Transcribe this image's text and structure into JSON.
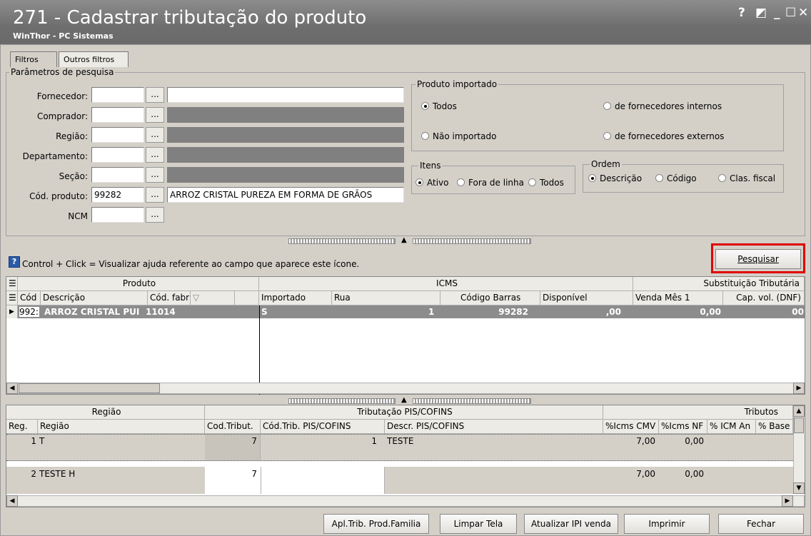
{
  "window": {
    "title": "271 - Cadastrar tributação do produto",
    "subtitle": "WinThor - PC Sistemas",
    "controls": [
      "?",
      "◩",
      "_",
      "☐",
      "✕"
    ]
  },
  "tabs": [
    "Filtros",
    "Outros filtros"
  ],
  "params": {
    "group_label": "Parâmetros de pesquisa",
    "fields": [
      {
        "label": "Fornecedor:",
        "code": "",
        "desc": ""
      },
      {
        "label": "Comprador:",
        "code": "",
        "desc": ""
      },
      {
        "label": "Região:",
        "code": "",
        "desc": ""
      },
      {
        "label": "Departamento:",
        "code": "",
        "desc": ""
      },
      {
        "label": "Seção:",
        "code": "",
        "desc": ""
      },
      {
        "label": "Cód. produto:",
        "code": "99282",
        "desc": "ARROZ  CRISTAL PUREZA EM FORMA DE GRÃOS"
      },
      {
        "label": "NCM",
        "code": "",
        "desc": ""
      }
    ],
    "dots": "..."
  },
  "importado": {
    "label": "Produto importado",
    "options": [
      "Todos",
      "de fornecedores internos",
      "Não importado",
      "de fornecedores externos"
    ],
    "selected": "Todos"
  },
  "itens": {
    "label": "Itens",
    "options": [
      "Ativo",
      "Fora de linha",
      "Todos"
    ],
    "selected": "Ativo"
  },
  "ordem": {
    "label": "Ordem",
    "options": [
      "Descrição",
      "Código",
      "Clas. fiscal"
    ],
    "selected": "Descrição"
  },
  "help_text": "Control + Click = Visualizar ajuda referente ao campo que aparece este ícone.",
  "search_button": "Pesquisar",
  "grid1": {
    "groups": [
      "Produto",
      "ICMS",
      "Substituição Tributária"
    ],
    "columns": [
      "Cód",
      "Descrição",
      "Cód. fabrica",
      "Importado",
      "Rua",
      "Código Barras",
      "Disponível",
      "Venda Mês 1",
      "Cap. vol. (DNF)"
    ],
    "row": {
      "cod": "992:",
      "desc": "ARROZ  CRISTAL PUI",
      "fabrica": "11014",
      "importado": "S",
      "rua": "1",
      "barras": "99282",
      "disponivel": ",00",
      "venda": "0,00",
      "cap": "00"
    }
  },
  "grid2": {
    "groups": [
      "Região",
      "Tributação PIS/COFINS",
      "Tributos"
    ],
    "columns": [
      "Reg.",
      "Região",
      "Cod.Tribut.",
      "Cód.Trib. PIS/COFINS",
      "Descr. PIS/COFINS",
      "%Icms CMV",
      "%Icms NF",
      "% ICM An",
      "% Base"
    ],
    "rows": [
      {
        "reg": "1",
        "regiao": "T",
        "codtrib": "7",
        "codpis": "1",
        "descr": "TESTE",
        "cmv": "7,00",
        "nf": "0,00"
      },
      {
        "reg": "2",
        "regiao": "TESTE H",
        "codtrib": "7",
        "codpis": "",
        "descr": "",
        "cmv": "7,00",
        "nf": "0,00"
      }
    ]
  },
  "footer_buttons": [
    "Apl.Trib. Prod.Familia",
    "Limpar Tela",
    "Atualizar IPI venda",
    "Imprimir",
    "Fechar"
  ],
  "colors": {
    "highlight_border": "#e00000",
    "selected_row": "#8c8c8c",
    "disabled_field": "#808080"
  }
}
